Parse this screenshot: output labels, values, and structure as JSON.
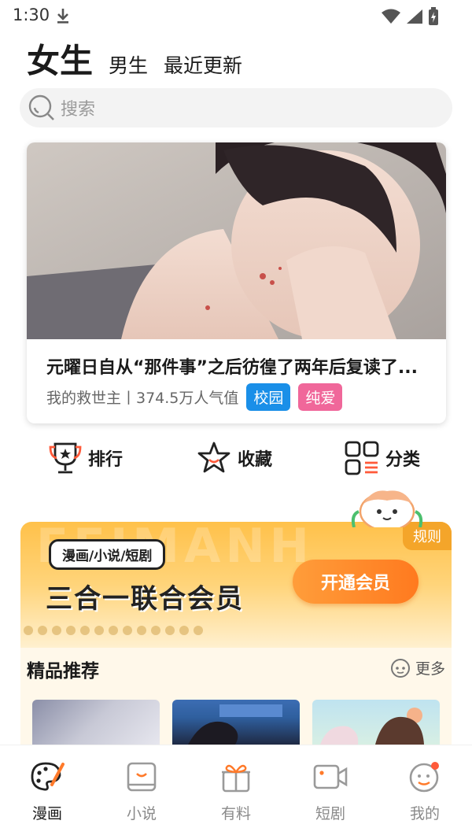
{
  "status_bar": {
    "time": "1:30",
    "icons": [
      "download-icon",
      "wifi-icon",
      "signal-icon",
      "battery-icon"
    ]
  },
  "top_tabs": [
    {
      "label": "女生",
      "active": true
    },
    {
      "label": "男生",
      "active": false
    },
    {
      "label": "最近更新",
      "active": false
    }
  ],
  "search": {
    "placeholder": "搜索",
    "icon": "search-icon"
  },
  "featured": {
    "title": "元曜日自从“那件事”之后彷徨了两年后复读了...",
    "subtitle": "我的救世主丨374.5万人气值",
    "tags": [
      {
        "label": "校园",
        "color": "#1a8fe8"
      },
      {
        "label": "纯爱",
        "color": "#f0679a"
      }
    ]
  },
  "quick_actions": [
    {
      "label": "排行",
      "icon": "trophy-icon"
    },
    {
      "label": "收藏",
      "icon": "star-icon"
    },
    {
      "label": "分类",
      "icon": "grid-icon"
    }
  ],
  "vip": {
    "bg_text": "FEIMANH",
    "rule": "规则",
    "bubble": "漫画/小说/短剧",
    "headline": "三合一联合会员",
    "button": "开通会员"
  },
  "recommend": {
    "title": "精品推荐",
    "more": "更多"
  },
  "bottom_nav": [
    {
      "label": "漫画",
      "icon": "palette-icon",
      "active": true
    },
    {
      "label": "小说",
      "icon": "book-icon",
      "active": false
    },
    {
      "label": "有料",
      "icon": "gift-icon",
      "active": false
    },
    {
      "label": "短剧",
      "icon": "video-icon",
      "active": false
    },
    {
      "label": "我的",
      "icon": "profile-icon",
      "active": false
    }
  ],
  "colors": {
    "accent_orange": "#ff8a2a",
    "vip_yellow": "#ffc14a",
    "tag_blue": "#1a8fe8",
    "tag_pink": "#f0679a",
    "badge_red": "#ff5a3a"
  }
}
